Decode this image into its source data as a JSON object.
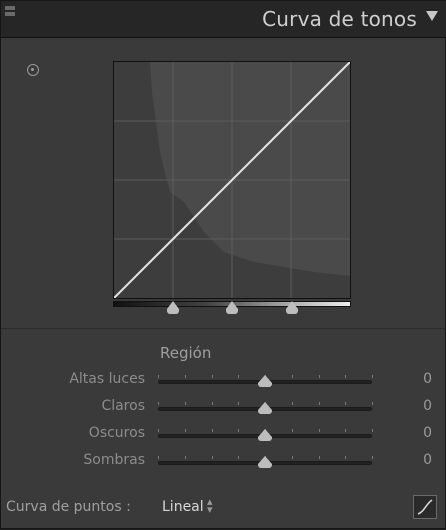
{
  "header": {
    "title": "Curva de tonos",
    "collapse_icon": "collapse-triangle-icon"
  },
  "curve": {
    "points": [
      [
        0,
        0
      ],
      [
        100,
        100
      ]
    ],
    "axis_range": [
      0,
      100
    ],
    "split_points": [
      25,
      50,
      75
    ]
  },
  "region": {
    "title": "Región",
    "sliders": [
      {
        "label": "Altas luces",
        "value": "0",
        "position": 0.5
      },
      {
        "label": "Claros",
        "value": "0",
        "position": 0.5
      },
      {
        "label": "Oscuros",
        "value": "0",
        "position": 0.5
      },
      {
        "label": "Sombras",
        "value": "0",
        "position": 0.5
      }
    ]
  },
  "point_curve": {
    "label": "Curva de puntos :",
    "value": "Lineal"
  },
  "colors": {
    "panel": "#3a3a3a",
    "header": "#262626",
    "curve_bg": "#4a4a4a",
    "line": "#e8e8e8"
  }
}
